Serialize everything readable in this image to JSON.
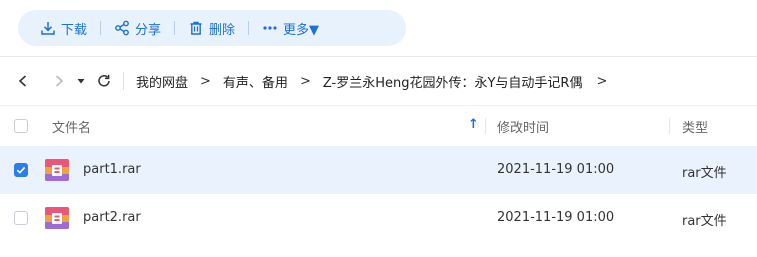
{
  "toolbar": {
    "download": "下载",
    "share": "分享",
    "delete": "删除",
    "more": "更多▼"
  },
  "nav": {
    "breadcrumbs": [
      "我的网盘",
      "有声、备用",
      "Z-罗兰永Heng花园外传：永Y与自动手记R偶"
    ],
    "separator": ">"
  },
  "table": {
    "headers": {
      "name": "文件名",
      "modified": "修改时间",
      "type": "类型"
    },
    "sort_indicator": "↑",
    "rows": [
      {
        "name": "part1.rar",
        "modified": "2021-11-19 01:00",
        "type": "rar文件",
        "selected": true
      },
      {
        "name": "part2.rar",
        "modified": "2021-11-19 01:00",
        "type": "rar文件",
        "selected": false
      }
    ]
  },
  "colors": {
    "accent": "#1e6fd9",
    "selected_row": "#eaf3fd",
    "toolbar_bg": "#e8f2fd"
  }
}
